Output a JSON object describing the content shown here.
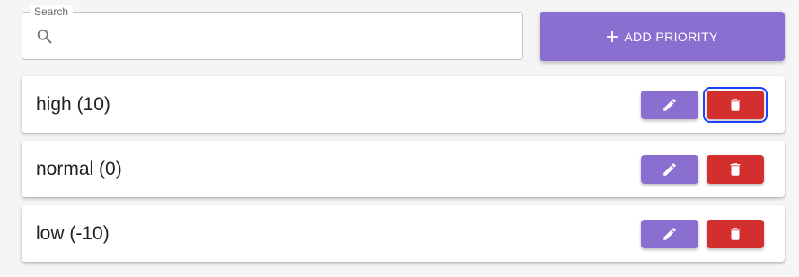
{
  "search": {
    "label": "Search",
    "value": "",
    "placeholder": "",
    "icon": "search-icon"
  },
  "add_button": {
    "label": "ADD PRIORITY",
    "icon": "plus-icon"
  },
  "priorities": [
    {
      "label": "high (10)"
    },
    {
      "label": "normal (0)"
    },
    {
      "label": "low (-10)"
    }
  ],
  "actions": {
    "edit_icon": "pencil-icon",
    "delete_icon": "trash-icon"
  },
  "colors": {
    "primary": "#8a6fd0",
    "danger": "#d32f2f",
    "focus_ring": "#1e40ff"
  }
}
